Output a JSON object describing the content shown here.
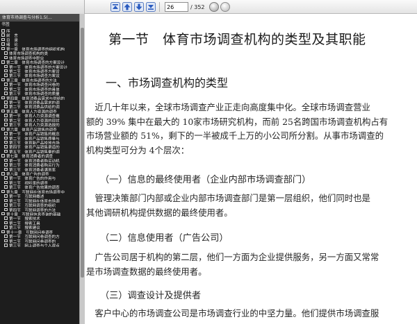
{
  "toolbar": {
    "page_current": "26",
    "page_total": "/ 352"
  },
  "sidebar": {
    "tab_title": "体育市场调查与分析1.5(…",
    "outline_header": "书签",
    "items": [
      {
        "label": "序",
        "indent": 0
      },
      {
        "label": "前　言",
        "indent": 0
      },
      {
        "label": "目　录",
        "indent": 0
      },
      {
        "label": "绪　论",
        "indent": 0
      },
      {
        "label": "第一章　体育市场调查的组织机构",
        "indent": 0
      },
      {
        "label": "体育市场调查机构的类",
        "indent": 1
      },
      {
        "label": "体育市场调查中职业",
        "indent": 1
      },
      {
        "label": "第二章　体育市场调查的方案设计",
        "indent": 0
      },
      {
        "label": "第一节　体育市场调查的方案设计",
        "indent": 1
      },
      {
        "label": "第二节　体育市场调查方案设",
        "indent": 1
      },
      {
        "label": "第三节　体育市场调查方案设",
        "indent": 1
      },
      {
        "label": "第三章　体育市场调查的方法",
        "indent": 0
      },
      {
        "label": "第一节　体育市场调查问卷的",
        "indent": 1
      },
      {
        "label": "第二节　体育市场调查的具体",
        "indent": 1
      },
      {
        "label": "第三节　体育市场调查的质量",
        "indent": 1
      },
      {
        "label": "第四章　体育消费品需求与供给的",
        "indent": 0
      },
      {
        "label": "第一节　体育消费品需求的调",
        "indent": 1
      },
      {
        "label": "第二节　体育消费品供给的调",
        "indent": 1
      },
      {
        "label": "第五章　体育人力资源的调查",
        "indent": 0
      },
      {
        "label": "第一节　体育人力资源调查概",
        "indent": 1
      },
      {
        "label": "第二节　体育人力资源的现状",
        "indent": 1
      },
      {
        "label": "第三节　体育人力资源选拔的",
        "indent": 1
      },
      {
        "label": "第六章　体育产品销售的调查",
        "indent": 0
      },
      {
        "label": "第一节　体育产品销售的概念",
        "indent": 1
      },
      {
        "label": "第二节　体育产品销售质量与",
        "indent": 1
      },
      {
        "label": "第三节　体育新产品投放市场",
        "indent": 1
      },
      {
        "label": "第四节　体育产品销售渠道的",
        "indent": 1
      },
      {
        "label": "第五节　体育产品销售量的调",
        "indent": 1
      },
      {
        "label": "第七章　体育消费者的调查",
        "indent": 0
      },
      {
        "label": "第一节　体育消费者购买动机",
        "indent": 1
      },
      {
        "label": "第二节　体育消费者购买行为",
        "indent": 1
      },
      {
        "label": "第三节　体育消费者满意率",
        "indent": 1
      },
      {
        "label": "第八章　体育广告的调查",
        "indent": 0
      },
      {
        "label": "第一节　体育广告的作用与",
        "indent": 1
      },
      {
        "label": "第二节　视听率的调查",
        "indent": 1
      },
      {
        "label": "第三节　体育广告效果的调查",
        "indent": 1
      },
      {
        "label": "第九章　互联网在体育市场调查中",
        "indent": 0
      },
      {
        "label": "第一节　互联网概述",
        "indent": 1
      },
      {
        "label": "第二节　互联网在体育市场调",
        "indent": 1
      },
      {
        "label": "第三节　互联网调查的组织",
        "indent": 1
      },
      {
        "label": "第四节　互联网调查的方法",
        "indent": 1
      },
      {
        "label": "第十章　互联网信息查询的基础",
        "indent": 0
      },
      {
        "label": "第一节　搜索技术",
        "indent": 1
      },
      {
        "label": "第二节　搜索工具",
        "indent": 1
      },
      {
        "label": "第三节　搜索建议",
        "indent": 1
      },
      {
        "label": "第十一章　互联网问卷调查",
        "indent": 0
      },
      {
        "label": "第一节　互联网问卷调查的方",
        "indent": 1
      },
      {
        "label": "第二节　互联网问卷调查的",
        "indent": 1
      },
      {
        "label": "第三节　网上调查与个人观点",
        "indent": 1
      }
    ]
  },
  "document": {
    "title": "第一节　体育市场调查机构的类型及其职能",
    "heading": "一、市场调查机构的类型",
    "para1": [
      "　近几十年以来，全球市场调查产业正走向高度集中化。全球市场调查营业",
      "额的 39% 集中在最大的 10家市场研究机构，而前 25名跨国市场调查机构占有",
      "市场营业额的 51%，剩下的一半被成千上万的小公司所分割。从事市场调查的",
      "机构类型可分为 4个层次："
    ],
    "sub1": "（一）信息的最终使用者（企业内部市场调查部门）",
    "para2": [
      "　管理决策部门内部或企业内部市场调查部门是第一层组织，他们同时也是",
      "其他调研机构提供数据的最终使用者。"
    ],
    "sub2": "（二）信息使用者（广告公司）",
    "para3": [
      "　广告公司居于机构的第二层，他们一方面为企业提供服务，另一方面又常常",
      "是市场调查数据的最终使用者。"
    ],
    "sub3": "（三）调查设计及提供者",
    "para4": [
      "　客户中心的市场调查公司是市场调查行业的中坚力量。他们提供市场调查服"
    ]
  }
}
